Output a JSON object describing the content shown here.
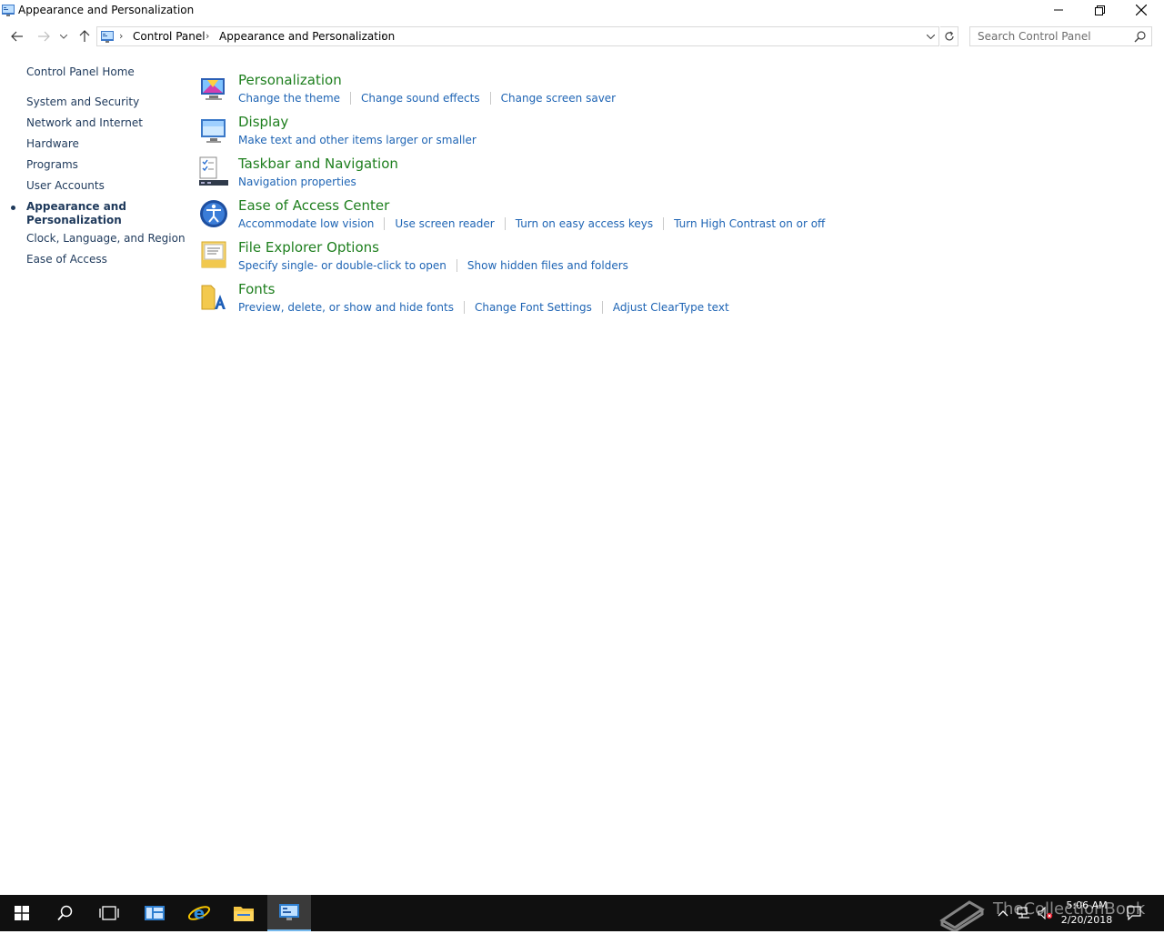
{
  "window": {
    "title": "Appearance and Personalization"
  },
  "address": {
    "crumbs": [
      "Control Panel",
      "Appearance and Personalization"
    ],
    "search_placeholder": "Search Control Panel"
  },
  "leftnav": {
    "home": "Control Panel Home",
    "items": [
      "System and Security",
      "Network and Internet",
      "Hardware",
      "Programs",
      "User Accounts",
      "Appearance and Personalization",
      "Clock, Language, and Region",
      "Ease of Access"
    ],
    "current_index": 5
  },
  "sections": [
    {
      "title": "Personalization",
      "icon": "personalization-icon",
      "links": [
        "Change the theme",
        "Change sound effects",
        "Change screen saver"
      ]
    },
    {
      "title": "Display",
      "icon": "display-icon",
      "links": [
        "Make text and other items larger or smaller"
      ]
    },
    {
      "title": "Taskbar and Navigation",
      "icon": "taskbar-icon",
      "links": [
        "Navigation properties"
      ]
    },
    {
      "title": "Ease of Access Center",
      "icon": "ease-of-access-icon",
      "links": [
        "Accommodate low vision",
        "Use screen reader",
        "Turn on easy access keys",
        "Turn High Contrast on or off"
      ]
    },
    {
      "title": "File Explorer Options",
      "icon": "folder-options-icon",
      "links": [
        "Specify single- or double-click to open",
        "Show hidden files and folders"
      ]
    },
    {
      "title": "Fonts",
      "icon": "fonts-icon",
      "links": [
        "Preview, delete, or show and hide fonts",
        "Change Font Settings",
        "Adjust ClearType text"
      ]
    }
  ],
  "taskbar": {
    "time": "5:06 AM",
    "date": "2/20/2018",
    "watermark": "TheCollectionBook"
  },
  "colors": {
    "section_title": "#1e7f1e",
    "link": "#1e64b4",
    "nav_text": "#1e395b",
    "taskbar": "#101010"
  }
}
